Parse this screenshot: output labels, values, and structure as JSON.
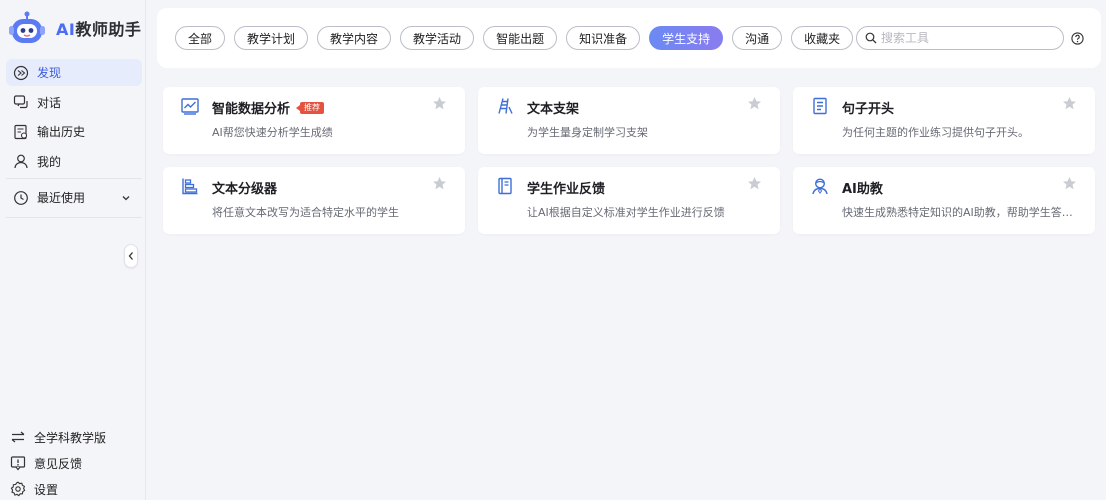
{
  "app": {
    "logo_ai": "AI",
    "logo_name": "教师助手"
  },
  "sidebar": {
    "items": [
      {
        "label": "发现",
        "icon": "discover-icon",
        "active": true
      },
      {
        "label": "对话",
        "icon": "chat-icon",
        "active": false
      },
      {
        "label": "输出历史",
        "icon": "history-doc-icon",
        "active": false
      },
      {
        "label": "我的",
        "icon": "user-icon",
        "active": false
      }
    ],
    "recent": {
      "label": "最近使用",
      "icon": "clock-icon"
    },
    "bottom": [
      {
        "label": "全学科教学版",
        "icon": "switch-icon"
      },
      {
        "label": "意见反馈",
        "icon": "feedback-icon"
      },
      {
        "label": "设置",
        "icon": "gear-icon"
      }
    ]
  },
  "tabs": [
    {
      "label": "全部",
      "active": false
    },
    {
      "label": "教学计划",
      "active": false
    },
    {
      "label": "教学内容",
      "active": false
    },
    {
      "label": "教学活动",
      "active": false
    },
    {
      "label": "智能出题",
      "active": false
    },
    {
      "label": "知识准备",
      "active": false
    },
    {
      "label": "学生支持",
      "active": true
    },
    {
      "label": "沟通",
      "active": false
    },
    {
      "label": "收藏夹",
      "active": false
    }
  ],
  "search": {
    "placeholder": "搜索工具"
  },
  "cards": [
    {
      "title": "智能数据分析",
      "badge": "推荐",
      "desc": "AI帮您快速分析学生成绩",
      "icon": "chart-board-icon"
    },
    {
      "title": "文本支架",
      "desc": "为学生量身定制学习支架",
      "icon": "ladder-icon"
    },
    {
      "title": "句子开头",
      "desc": "为任何主题的作业练习提供句子开头。",
      "icon": "document-lines-icon"
    },
    {
      "title": "文本分级器",
      "desc": "将任意文本改写为适合特定水平的学生",
      "icon": "level-bars-icon"
    },
    {
      "title": "学生作业反馈",
      "desc": "让AI根据自定义标准对学生作业进行反馈",
      "icon": "notebook-icon"
    },
    {
      "title": "AI助教",
      "desc": "快速生成熟悉特定知识的AI助教，帮助学生答疑解惑",
      "icon": "assistant-person-icon"
    }
  ],
  "colors": {
    "accent": "#4a6cf7",
    "active_bg": "#e6ecfb",
    "badge": "#e5523f",
    "icon_blue": "#3e6fd8"
  }
}
